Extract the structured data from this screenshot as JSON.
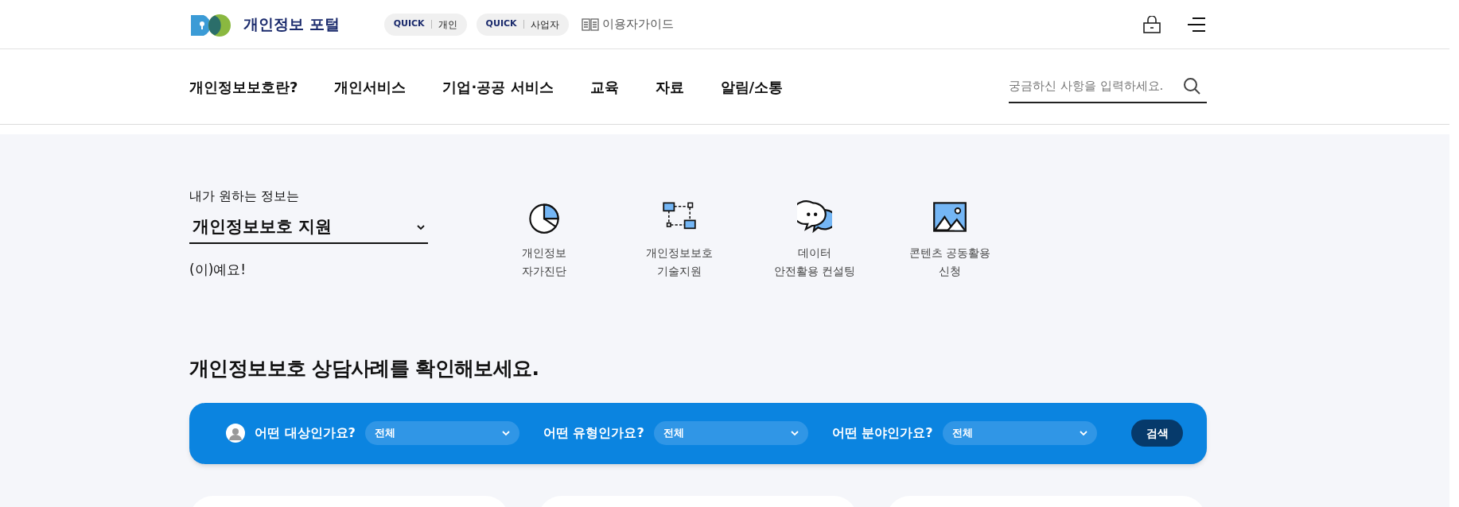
{
  "header": {
    "logo_text": "개인정보 포털",
    "quick_links": [
      {
        "tag": "QUICK",
        "label": "개인"
      },
      {
        "tag": "QUICK",
        "label": "사업자"
      }
    ],
    "guide_link": "이용자가이드"
  },
  "nav": {
    "items": [
      "개인정보보호란?",
      "개인서비스",
      "기업·공공 서비스",
      "교육",
      "자료",
      "알림/소통"
    ],
    "search": {
      "placeholder": "궁금하신 사항을 입력하세요."
    }
  },
  "finder": {
    "intro": "내가 원하는 정보는",
    "select_value": "개인정보보호 지원",
    "suffix": "(이)예요!",
    "shortcuts": [
      {
        "kind": "chart",
        "lines": [
          "개인정보",
          "자가진단"
        ]
      },
      {
        "kind": "network",
        "lines": [
          "개인정보보호",
          "기술지원"
        ]
      },
      {
        "kind": "chat",
        "lines": [
          "데이터",
          "안전활용 컨설팅"
        ]
      },
      {
        "kind": "image",
        "lines": [
          "콘텐츠 공동활용",
          "신청"
        ]
      }
    ]
  },
  "cases": {
    "heading": "개인정보보호 상담사례를 확인해보세요.",
    "filters": [
      {
        "label": "어떤 대상인가요?",
        "value": "전체"
      },
      {
        "label": "어떤 유형인가요?",
        "value": "전체"
      },
      {
        "label": "어떤 분야인가요?",
        "value": "전체"
      }
    ],
    "button": "검색"
  }
}
